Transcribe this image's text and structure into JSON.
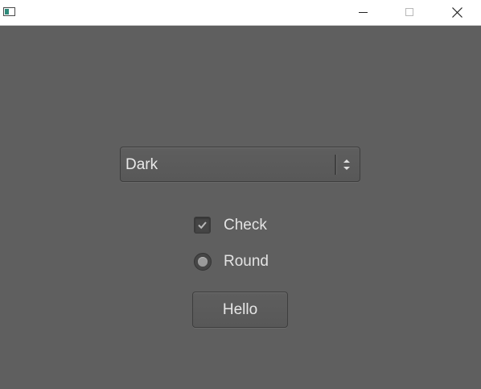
{
  "titlebar": {
    "icon": "app-window-icon",
    "minimize_icon": "minimize-icon",
    "maximize_icon": "maximize-icon",
    "close_icon": "close-icon"
  },
  "combo": {
    "selected": "Dark",
    "arrow_icon": "up-down-arrows-icon"
  },
  "checkbox": {
    "label": "Check",
    "checked": true
  },
  "radio": {
    "label": "Round",
    "selected": true
  },
  "button": {
    "label": "Hello"
  },
  "colors": {
    "window_bg": "#5f5f5f",
    "titlebar_bg": "#ffffff",
    "text": "#e3e3e3"
  }
}
